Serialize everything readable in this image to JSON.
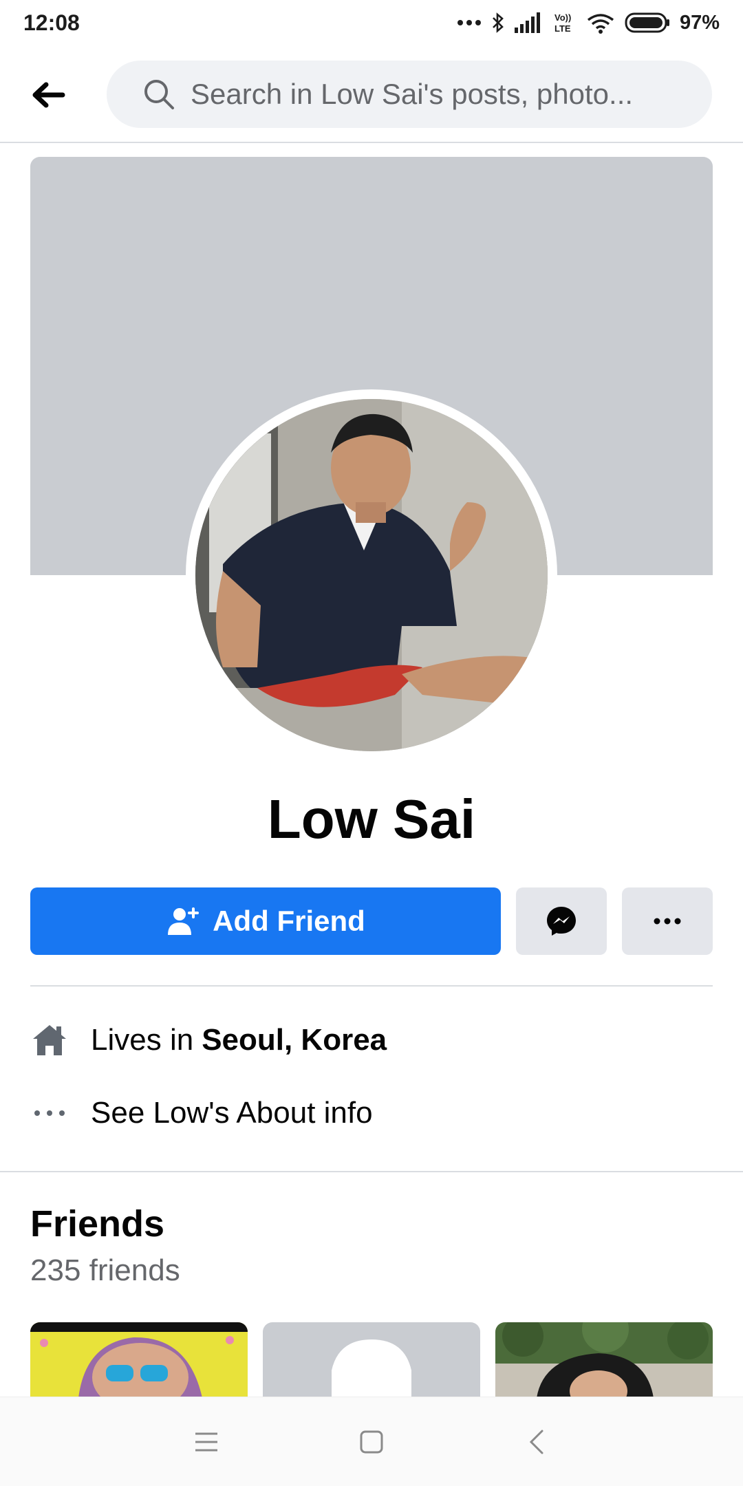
{
  "status_bar": {
    "time": "12:08",
    "battery": "97%",
    "icons": [
      "dots-icon",
      "bluetooth-icon",
      "signal-icon",
      "volte-icon",
      "wifi-icon",
      "battery-icon"
    ]
  },
  "search": {
    "placeholder": "Search in Low Sai's posts, photo..."
  },
  "profile": {
    "name": "Low Sai"
  },
  "actions": {
    "add_friend_label": "Add Friend"
  },
  "about": {
    "lives_prefix": "Lives in",
    "lives_place": "Seoul, Korea",
    "see_about": "See Low's About info"
  },
  "friends": {
    "title": "Friends",
    "count": "235 friends"
  },
  "colors": {
    "primary": "#1877f2",
    "secondary_button": "#e4e6eb",
    "cover": "#c9ccd1",
    "muted_text": "#65676b"
  }
}
